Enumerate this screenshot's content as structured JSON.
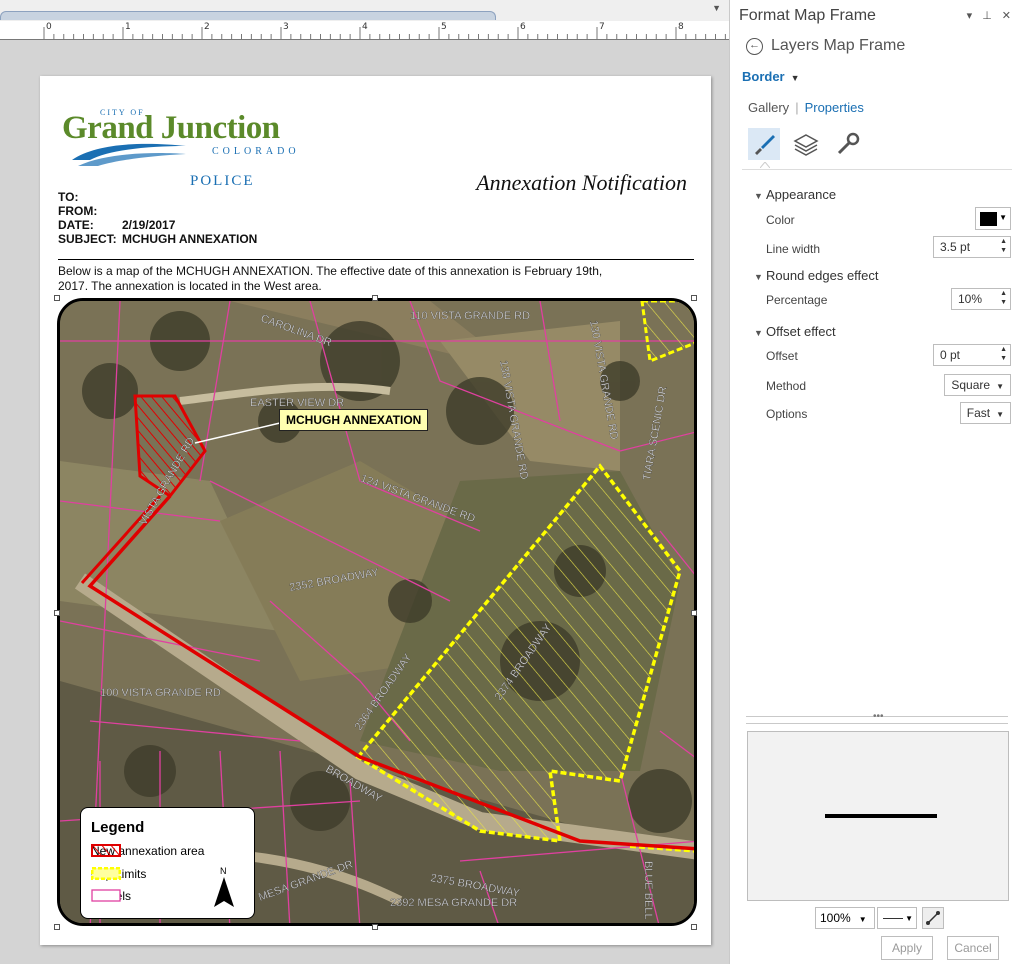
{
  "layout": {
    "ruler_ticks": [
      "0",
      "1",
      "2",
      "3",
      "4",
      "5",
      "6",
      "7",
      "8"
    ]
  },
  "page": {
    "logo": {
      "city_of": "CITY OF",
      "name": "Grand Junction",
      "state": "COLORADO",
      "dept": "POLICE"
    },
    "memo_title": "Annexation Notification",
    "memo": {
      "to_label": "TO:",
      "from_label": "FROM:",
      "date_label": "DATE:",
      "date_value": "2/19/2017",
      "subject_label": "SUBJECT:",
      "subject_value": "MCHUGH ANNEXATION"
    },
    "body_text": "Below is a map of the MCHUGH ANNEXATION.  The effective date of this annexation is February 19th, 2017.  The annexation is located in the West area.",
    "map": {
      "callout": "MCHUGH ANNEXATION",
      "street_labels": [
        "CAROLINA DR",
        "110 VISTA GRANDE RD",
        "138 VISTA GRANDE RD",
        "130 VISTA GRANDE RD",
        "EASTER VIEW DR",
        "VISTA GRANDE RD",
        "124 VISTA GRANDE RD",
        "2352 BROADWAY",
        "2364 BROADWAY",
        "2374 BROADWAY",
        "100 VISTA GRANDE RD",
        "BROADWAY",
        "MESA GRANDE DR",
        "2375 BROADWAY",
        "2392 MESA GRANDE DR",
        "BLUE BELL LN",
        "TIARA SCENIC DR"
      ],
      "legend": {
        "title": "Legend",
        "items": [
          "New annexation area",
          "City Limits",
          "Parcels"
        ],
        "north": "N"
      }
    }
  },
  "panel": {
    "title": "Format Map Frame",
    "back_label": "Layers Map Frame",
    "border_label": "Border",
    "tabs": [
      "Gallery",
      "Properties"
    ],
    "appearance": {
      "header": "Appearance",
      "color_label": "Color",
      "color_value": "#000000",
      "line_width_label": "Line width",
      "line_width_value": "3.5 pt"
    },
    "round_edges": {
      "header": "Round edges effect",
      "percentage_label": "Percentage",
      "percentage_value": "10%"
    },
    "offset": {
      "header": "Offset effect",
      "offset_label": "Offset",
      "offset_value": "0 pt",
      "method_label": "Method",
      "method_value": "Square",
      "options_label": "Options",
      "options_value": "Fast"
    },
    "preview_zoom": "100%",
    "apply": "Apply",
    "cancel": "Cancel"
  },
  "colors": {
    "accent": "#1a6fb3",
    "annexation": "#e00000",
    "city_limits": "#ffff00",
    "parcels": "#e040a0"
  }
}
